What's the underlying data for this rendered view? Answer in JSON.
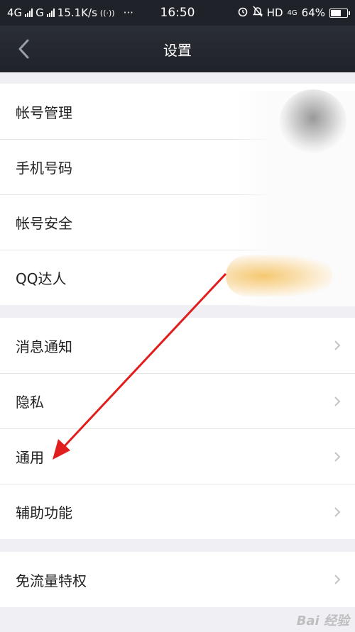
{
  "status_bar": {
    "network_1": "4G",
    "network_2": "G",
    "speed": "15.1K/s",
    "dots": "···",
    "time": "16:50",
    "hd": "HD",
    "battery": "64%",
    "battery_level": 0.64
  },
  "navbar": {
    "title": "设置"
  },
  "groups": {
    "account": [
      "帐号管理",
      "手机号码",
      "帐号安全",
      "QQ达人"
    ],
    "general": [
      "消息通知",
      "隐私",
      "通用",
      "辅助功能"
    ],
    "data": [
      "免流量特权"
    ]
  },
  "watermark": "Bai 经验",
  "colors": {
    "navbar": "#1f2329",
    "arrow": "#e11d1d",
    "background": "#efeff4"
  }
}
